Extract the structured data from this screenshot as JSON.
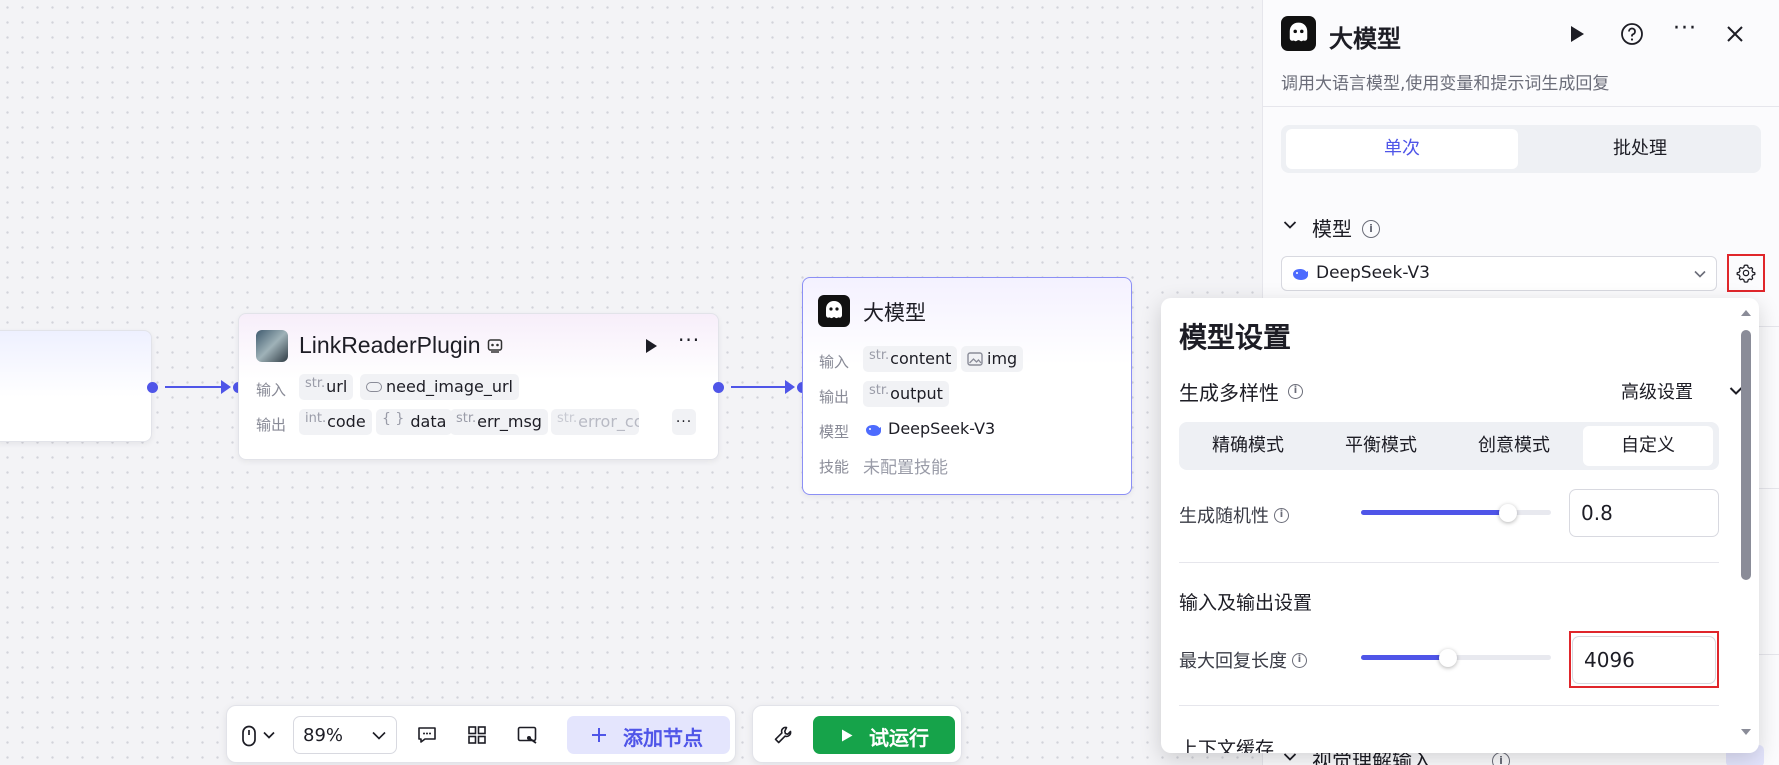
{
  "canvas": {
    "plugin_node": {
      "title": "LinkReaderPlugin",
      "inputs_label": "输入",
      "outputs_label": "输出",
      "inputs": [
        {
          "type": "str.",
          "name": "url"
        },
        {
          "type": "toggle",
          "name": "need_image_url"
        }
      ],
      "outputs": [
        {
          "type": "int.",
          "name": "code"
        },
        {
          "type": "{ }",
          "name": "data"
        },
        {
          "type": "str.",
          "name": "err_msg"
        },
        {
          "type": "str.",
          "name": "error_co"
        }
      ],
      "more": "···"
    },
    "llm_node": {
      "title": "大模型",
      "inputs_label": "输入",
      "outputs_label": "输出",
      "model_label": "模型",
      "skills_label": "技能",
      "inputs": [
        {
          "type": "str.",
          "name": "content"
        },
        {
          "type": "image",
          "name": "img"
        }
      ],
      "outputs": [
        {
          "type": "str.",
          "name": "output"
        }
      ],
      "model": "DeepSeek-V3",
      "skills": "未配置技能"
    }
  },
  "toolbar": {
    "zoom": "89%",
    "add_node": "添加节点",
    "test_run": "试运行"
  },
  "panel": {
    "title": "大模型",
    "description": "调用大语言模型,使用变量和提示词生成回复",
    "tabs": [
      "单次",
      "批处理"
    ],
    "active_tab": "单次",
    "model_section": "模型",
    "selected_model": "DeepSeek-V3",
    "next_section": "视觉理解输入"
  },
  "model_settings": {
    "title": "模型设置",
    "diversity_label": "生成多样性",
    "advanced": "高级设置",
    "modes": [
      "精确模式",
      "平衡模式",
      "创意模式",
      "自定义"
    ],
    "active_mode": "自定义",
    "temperature_label": "生成随机性",
    "temperature": "0.8",
    "temperature_fraction": 0.8,
    "io_section": "输入及输出设置",
    "max_tokens_label": "最大回复长度",
    "max_tokens": "4096",
    "max_tokens_fraction": 0.5,
    "context_section": "上下文缓存"
  },
  "colors": {
    "accent": "#4f55e8",
    "run_green": "#16a34a",
    "highlight_red": "#e0262b"
  }
}
